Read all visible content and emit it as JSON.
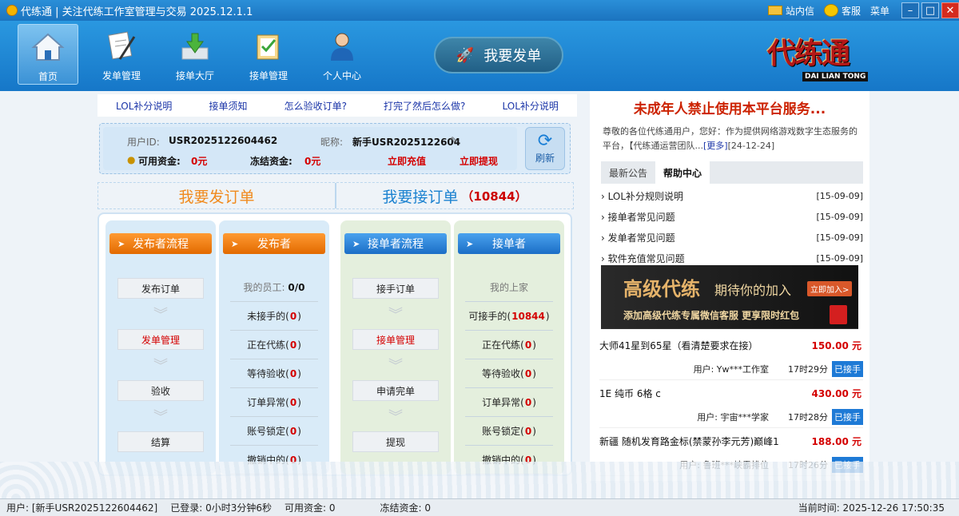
{
  "window": {
    "title": "代练通 | 关注代练工作室管理与交易 2025.12.1.1",
    "mail_label": "站内信",
    "service_label": "客服",
    "menu_label": "菜单"
  },
  "nav": {
    "items": [
      {
        "label": "首页",
        "icon": "home-icon"
      },
      {
        "label": "发单管理",
        "icon": "document-pen-icon"
      },
      {
        "label": "接单大厅",
        "icon": "download-tray-icon"
      },
      {
        "label": "接单管理",
        "icon": "clipboard-check-icon"
      },
      {
        "label": "个人中心",
        "icon": "user-icon"
      }
    ],
    "publish_button": "我要发单",
    "brand_title": "代练通",
    "brand_sub": "DAI LIAN TONG"
  },
  "links": [
    "LOL补分说明",
    "接单须知",
    "怎么验收订单?",
    "打完了然后怎么做?",
    "LOL补分说明"
  ],
  "user": {
    "id_label": "用户ID:",
    "id": "USR2025122604462",
    "nick_label": "昵称:",
    "nick": "新手USR2025122604",
    "avail_label": "可用资金:",
    "avail": "0元",
    "frozen_label": "冻结资金:",
    "frozen": "0元",
    "recharge": "立即充值",
    "withdraw": "立即提现",
    "refresh": "刷新"
  },
  "order_titles": {
    "publish": "我要发订单",
    "accept": "我要接订单",
    "accept_count": "（10844）"
  },
  "publisher_flow": {
    "title": "发布者流程",
    "steps": [
      "发布订单",
      "发单管理",
      "验收",
      "结算"
    ]
  },
  "publisher": {
    "title": "发布者",
    "head": "我的员工:",
    "head_val": "0/0",
    "stats": [
      {
        "label": "未接手的",
        "n": "0"
      },
      {
        "label": "正在代练",
        "n": "0"
      },
      {
        "label": "等待验收",
        "n": "0"
      },
      {
        "label": "订单异常",
        "n": "0"
      },
      {
        "label": "账号锁定",
        "n": "0"
      },
      {
        "label": "撤销中的",
        "n": "0"
      }
    ]
  },
  "acceptor_flow": {
    "title": "接单者流程",
    "steps": [
      "接手订单",
      "接单管理",
      "申请完单",
      "提现"
    ]
  },
  "acceptor": {
    "title": "接单者",
    "head": "我的上家",
    "stats": [
      {
        "label": "可接手的",
        "n": "10844"
      },
      {
        "label": "正在代练",
        "n": "0"
      },
      {
        "label": "等待验收",
        "n": "0"
      },
      {
        "label": "订单异常",
        "n": "0"
      },
      {
        "label": "账号锁定",
        "n": "0"
      },
      {
        "label": "撤销中的",
        "n": "0"
      }
    ]
  },
  "right": {
    "warning": "未成年人禁止使用本平台服务...",
    "notice": "尊敬的各位代练通用户，您好：作为提供网络游戏数字生态服务的平台，【代练通运营团队...",
    "notice_more": "[更多]",
    "notice_date": "[24-12-24]",
    "tabs": [
      "最新公告",
      "帮助中心"
    ],
    "help": [
      {
        "title": "LOL补分规则说明",
        "date": "[15-09-09]"
      },
      {
        "title": "接单者常见问题",
        "date": "[15-09-09]"
      },
      {
        "title": "发单者常见问题",
        "date": "[15-09-09]"
      },
      {
        "title": "软件充值常见问题",
        "date": "[15-09-09]"
      }
    ],
    "banner": {
      "big": "高级代练",
      "mid": "期待你的加入",
      "join": "立即加入>",
      "sub": "添加高级代练专属微信客服  更享限时红包"
    },
    "orders": [
      {
        "title": "大师41星到65星（看清楚要求在接）",
        "price": "150.00 元",
        "user": "用户: Yw***工作室",
        "time": "17时29分",
        "status": "已接手"
      },
      {
        "title": "1E 纯币 6格 c",
        "price": "430.00 元",
        "user": "用户: 宇宙***学家",
        "time": "17时28分",
        "status": "已接手"
      },
      {
        "title": "新疆 随机发育路金标(禁蒙孙李元芳)巅峰1",
        "price": "188.00 元",
        "user": "用户: 鲁班***峡霸排位",
        "time": "17时26分",
        "status": "已接手"
      }
    ]
  },
  "status": {
    "user": "用户: [新手USR2025122604462]",
    "logged": "已登录: 0小时3分钟6秒",
    "avail": "可用资金: 0",
    "frozen": "冻结资金: 0",
    "time": "当前时间: 2025-12-26 17:50:35"
  }
}
